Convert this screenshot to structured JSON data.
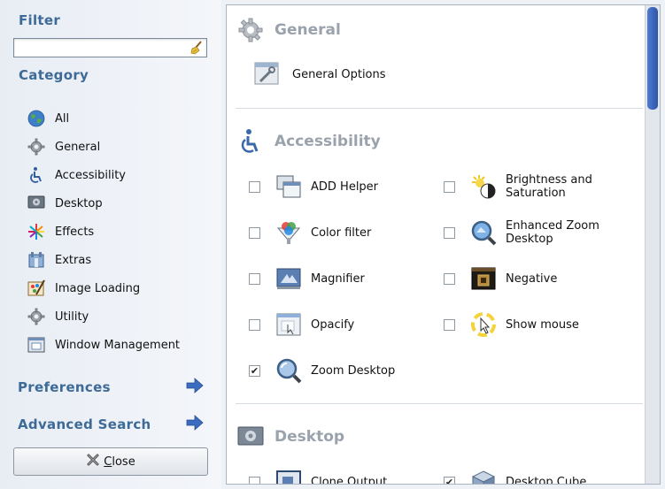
{
  "sidebar": {
    "filter_title": "Filter",
    "filter_value": "",
    "category_title": "Category",
    "categories": [
      {
        "label": "All",
        "icon": "globe-icon"
      },
      {
        "label": "General",
        "icon": "gear-icon"
      },
      {
        "label": "Accessibility",
        "icon": "accessibility-icon"
      },
      {
        "label": "Desktop",
        "icon": "desktop-icon"
      },
      {
        "label": "Effects",
        "icon": "effects-icon"
      },
      {
        "label": "Extras",
        "icon": "extras-icon"
      },
      {
        "label": "Image Loading",
        "icon": "image-loading-icon"
      },
      {
        "label": "Utility",
        "icon": "utility-icon"
      },
      {
        "label": "Window Management",
        "icon": "window-management-icon"
      }
    ],
    "preferences_label": "Preferences",
    "advanced_search_label": "Advanced Search",
    "close_label_first": "C",
    "close_label_rest": "lose"
  },
  "main": {
    "general": {
      "title": "General",
      "option_label": "General Options"
    },
    "accessibility": {
      "title": "Accessibility",
      "plugins": [
        {
          "label": "ADD Helper",
          "checked": false,
          "icon": "add-helper-icon"
        },
        {
          "label": "Brightness and Saturation",
          "checked": false,
          "icon": "brightness-icon"
        },
        {
          "label": "Color filter",
          "checked": false,
          "icon": "color-filter-icon"
        },
        {
          "label": "Enhanced Zoom Desktop",
          "checked": false,
          "icon": "enhanced-zoom-icon"
        },
        {
          "label": "Magnifier",
          "checked": false,
          "icon": "magnifier-icon"
        },
        {
          "label": "Negative",
          "checked": false,
          "icon": "negative-icon"
        },
        {
          "label": "Opacify",
          "checked": false,
          "icon": "opacify-icon"
        },
        {
          "label": "Show mouse",
          "checked": false,
          "icon": "show-mouse-icon"
        },
        {
          "label": "Zoom Desktop",
          "checked": true,
          "icon": "zoom-desktop-icon"
        }
      ]
    },
    "desktop": {
      "title": "Desktop",
      "plugins": [
        {
          "label": "Clone Output",
          "checked": false,
          "icon": "clone-output-icon"
        },
        {
          "label": "Desktop Cube",
          "checked": true,
          "icon": "desktop-cube-icon"
        }
      ]
    }
  },
  "colors": {
    "accent": "#3d6a96",
    "section_grey": "#9aa3ad",
    "scroll_thumb": "#3a63b8"
  }
}
